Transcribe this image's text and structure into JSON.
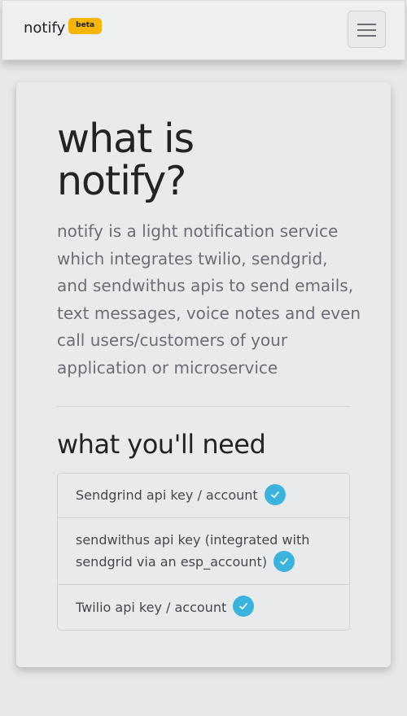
{
  "navbar": {
    "brand": "notify",
    "badge": "beta",
    "menu_icon": "hamburger-menu-icon"
  },
  "hero": {
    "title": "what is notify?",
    "description": "notify is a light notification service which integrates twilio, sendgrid, and sendwithus apis to send emails, text messages, voice notes and even call users/customers of your application or microservice"
  },
  "requirements": {
    "title": "what you'll need",
    "items": [
      {
        "label": "Sendgrind api key / account",
        "icon": "check-circle-icon"
      },
      {
        "label": "sendwithus api key (integrated with sendgrid via an esp_account)",
        "icon": "check-circle-icon"
      },
      {
        "label": "Twilio api key / account",
        "icon": "check-circle-icon"
      }
    ]
  },
  "colors": {
    "accent": "#3bb3dd",
    "badge": "#f5b50a",
    "background": "#e7e8ea"
  }
}
